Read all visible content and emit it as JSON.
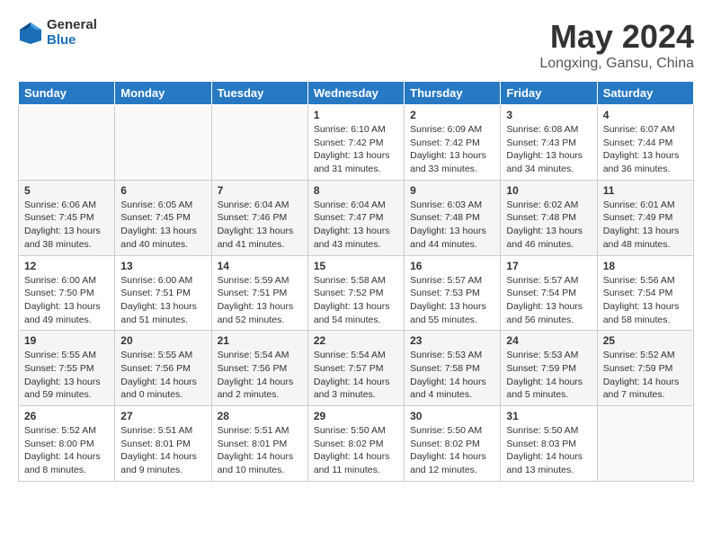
{
  "logo": {
    "general": "General",
    "blue": "Blue"
  },
  "title": "May 2024",
  "subtitle": "Longxing, Gansu, China",
  "days_header": [
    "Sunday",
    "Monday",
    "Tuesday",
    "Wednesday",
    "Thursday",
    "Friday",
    "Saturday"
  ],
  "weeks": [
    [
      {
        "day": "",
        "info": ""
      },
      {
        "day": "",
        "info": ""
      },
      {
        "day": "",
        "info": ""
      },
      {
        "day": "1",
        "info": "Sunrise: 6:10 AM\nSunset: 7:42 PM\nDaylight: 13 hours\nand 31 minutes."
      },
      {
        "day": "2",
        "info": "Sunrise: 6:09 AM\nSunset: 7:42 PM\nDaylight: 13 hours\nand 33 minutes."
      },
      {
        "day": "3",
        "info": "Sunrise: 6:08 AM\nSunset: 7:43 PM\nDaylight: 13 hours\nand 34 minutes."
      },
      {
        "day": "4",
        "info": "Sunrise: 6:07 AM\nSunset: 7:44 PM\nDaylight: 13 hours\nand 36 minutes."
      }
    ],
    [
      {
        "day": "5",
        "info": "Sunrise: 6:06 AM\nSunset: 7:45 PM\nDaylight: 13 hours\nand 38 minutes."
      },
      {
        "day": "6",
        "info": "Sunrise: 6:05 AM\nSunset: 7:45 PM\nDaylight: 13 hours\nand 40 minutes."
      },
      {
        "day": "7",
        "info": "Sunrise: 6:04 AM\nSunset: 7:46 PM\nDaylight: 13 hours\nand 41 minutes."
      },
      {
        "day": "8",
        "info": "Sunrise: 6:04 AM\nSunset: 7:47 PM\nDaylight: 13 hours\nand 43 minutes."
      },
      {
        "day": "9",
        "info": "Sunrise: 6:03 AM\nSunset: 7:48 PM\nDaylight: 13 hours\nand 44 minutes."
      },
      {
        "day": "10",
        "info": "Sunrise: 6:02 AM\nSunset: 7:48 PM\nDaylight: 13 hours\nand 46 minutes."
      },
      {
        "day": "11",
        "info": "Sunrise: 6:01 AM\nSunset: 7:49 PM\nDaylight: 13 hours\nand 48 minutes."
      }
    ],
    [
      {
        "day": "12",
        "info": "Sunrise: 6:00 AM\nSunset: 7:50 PM\nDaylight: 13 hours\nand 49 minutes."
      },
      {
        "day": "13",
        "info": "Sunrise: 6:00 AM\nSunset: 7:51 PM\nDaylight: 13 hours\nand 51 minutes."
      },
      {
        "day": "14",
        "info": "Sunrise: 5:59 AM\nSunset: 7:51 PM\nDaylight: 13 hours\nand 52 minutes."
      },
      {
        "day": "15",
        "info": "Sunrise: 5:58 AM\nSunset: 7:52 PM\nDaylight: 13 hours\nand 54 minutes."
      },
      {
        "day": "16",
        "info": "Sunrise: 5:57 AM\nSunset: 7:53 PM\nDaylight: 13 hours\nand 55 minutes."
      },
      {
        "day": "17",
        "info": "Sunrise: 5:57 AM\nSunset: 7:54 PM\nDaylight: 13 hours\nand 56 minutes."
      },
      {
        "day": "18",
        "info": "Sunrise: 5:56 AM\nSunset: 7:54 PM\nDaylight: 13 hours\nand 58 minutes."
      }
    ],
    [
      {
        "day": "19",
        "info": "Sunrise: 5:55 AM\nSunset: 7:55 PM\nDaylight: 13 hours\nand 59 minutes."
      },
      {
        "day": "20",
        "info": "Sunrise: 5:55 AM\nSunset: 7:56 PM\nDaylight: 14 hours\nand 0 minutes."
      },
      {
        "day": "21",
        "info": "Sunrise: 5:54 AM\nSunset: 7:56 PM\nDaylight: 14 hours\nand 2 minutes."
      },
      {
        "day": "22",
        "info": "Sunrise: 5:54 AM\nSunset: 7:57 PM\nDaylight: 14 hours\nand 3 minutes."
      },
      {
        "day": "23",
        "info": "Sunrise: 5:53 AM\nSunset: 7:58 PM\nDaylight: 14 hours\nand 4 minutes."
      },
      {
        "day": "24",
        "info": "Sunrise: 5:53 AM\nSunset: 7:59 PM\nDaylight: 14 hours\nand 5 minutes."
      },
      {
        "day": "25",
        "info": "Sunrise: 5:52 AM\nSunset: 7:59 PM\nDaylight: 14 hours\nand 7 minutes."
      }
    ],
    [
      {
        "day": "26",
        "info": "Sunrise: 5:52 AM\nSunset: 8:00 PM\nDaylight: 14 hours\nand 8 minutes."
      },
      {
        "day": "27",
        "info": "Sunrise: 5:51 AM\nSunset: 8:01 PM\nDaylight: 14 hours\nand 9 minutes."
      },
      {
        "day": "28",
        "info": "Sunrise: 5:51 AM\nSunset: 8:01 PM\nDaylight: 14 hours\nand 10 minutes."
      },
      {
        "day": "29",
        "info": "Sunrise: 5:50 AM\nSunset: 8:02 PM\nDaylight: 14 hours\nand 11 minutes."
      },
      {
        "day": "30",
        "info": "Sunrise: 5:50 AM\nSunset: 8:02 PM\nDaylight: 14 hours\nand 12 minutes."
      },
      {
        "day": "31",
        "info": "Sunrise: 5:50 AM\nSunset: 8:03 PM\nDaylight: 14 hours\nand 13 minutes."
      },
      {
        "day": "",
        "info": ""
      }
    ]
  ]
}
